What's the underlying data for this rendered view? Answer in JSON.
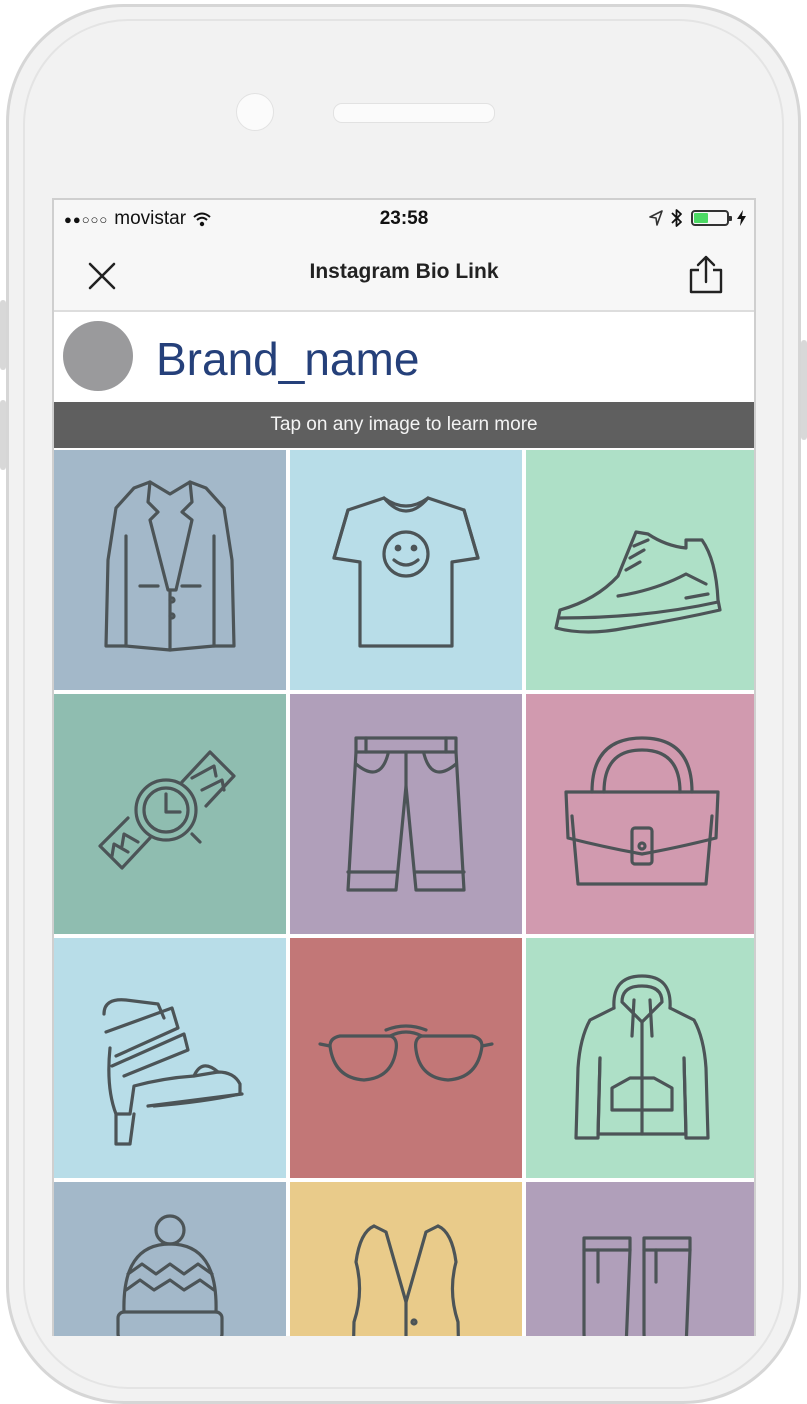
{
  "status_bar": {
    "signal": "●●○○○",
    "carrier": "movistar",
    "time": "23:58",
    "battery_level": 0.45,
    "battery_color": "#4cd964"
  },
  "nav": {
    "title": "Instagram Bio Link",
    "close_icon": "close-icon",
    "share_icon": "share-icon"
  },
  "profile": {
    "brand_name": "Brand_name",
    "brand_color": "#25407a",
    "avatar_color": "#9a9a9c"
  },
  "banner": {
    "text": "Tap on any image to learn more",
    "background": "#5f5f5f"
  },
  "tiles": [
    {
      "icon": "blazer-icon",
      "color": "#a3b8c9"
    },
    {
      "icon": "tshirt-icon",
      "color": "#b8dde8"
    },
    {
      "icon": "sneaker-icon",
      "color": "#aee0c7"
    },
    {
      "icon": "watch-icon",
      "color": "#8fbdb0"
    },
    {
      "icon": "pants-icon",
      "color": "#b09fba"
    },
    {
      "icon": "handbag-icon",
      "color": "#d19aaf"
    },
    {
      "icon": "sandal-icon",
      "color": "#b8dde8"
    },
    {
      "icon": "sunglasses-icon",
      "color": "#c27777"
    },
    {
      "icon": "hoodie-icon",
      "color": "#aee0c7"
    },
    {
      "icon": "beanie-icon",
      "color": "#a3b8c9"
    },
    {
      "icon": "vest-icon",
      "color": "#e9cb8a"
    },
    {
      "icon": "socks-icon",
      "color": "#b09fba"
    }
  ]
}
